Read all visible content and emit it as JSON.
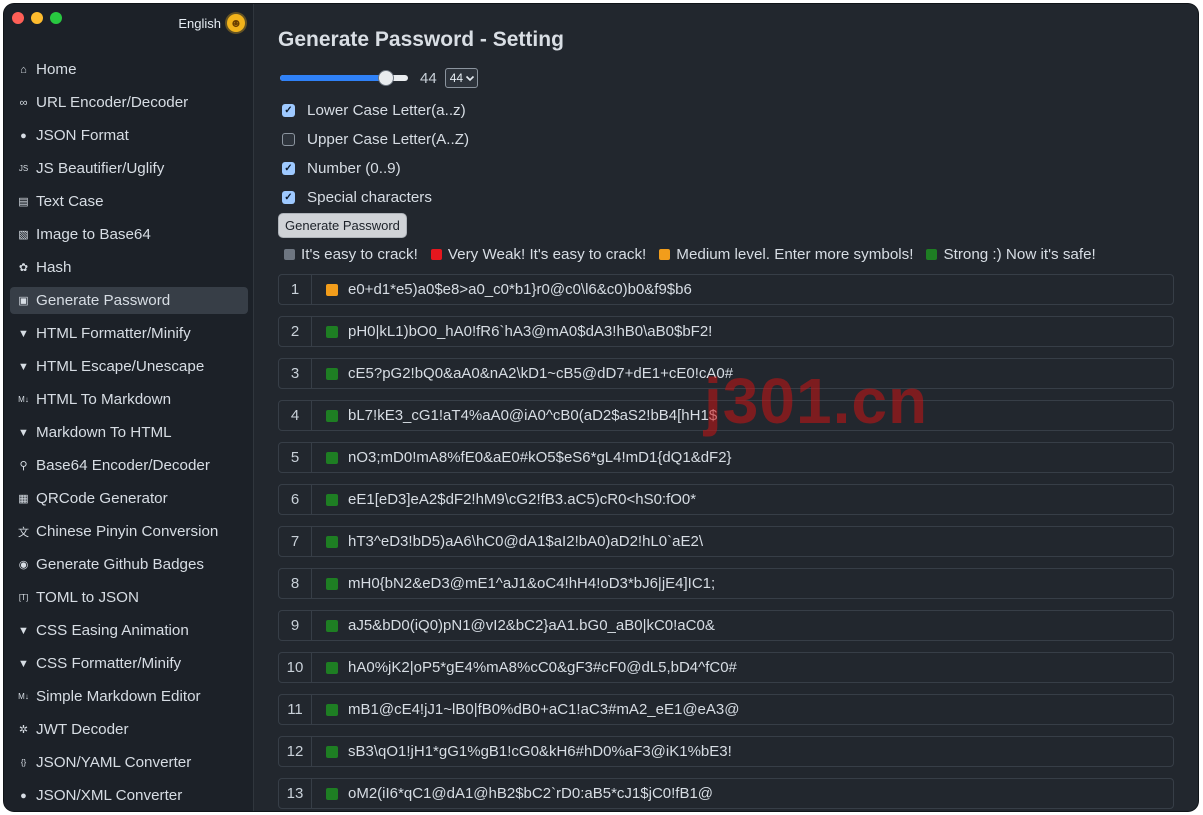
{
  "app": {
    "language": "English",
    "title": "Generate Password - Setting"
  },
  "colors": {
    "weak_gray": "#6e7681",
    "very_weak": "#e5171e",
    "medium": "#f29d1b",
    "strong": "#1e7e23"
  },
  "sidebar": {
    "items": [
      {
        "label": "Home",
        "icon": "home-icon"
      },
      {
        "label": "URL Encoder/Decoder",
        "icon": "link-icon"
      },
      {
        "label": "JSON Format",
        "icon": "json-icon"
      },
      {
        "label": "JS Beautifier/Uglify",
        "icon": "js-icon"
      },
      {
        "label": "Text Case",
        "icon": "text-case-icon"
      },
      {
        "label": "Image to Base64",
        "icon": "image-icon"
      },
      {
        "label": "Hash",
        "icon": "hash-icon"
      },
      {
        "label": "Generate Password",
        "icon": "lock-icon",
        "active": true
      },
      {
        "label": "HTML Formatter/Minify",
        "icon": "html5-icon"
      },
      {
        "label": "HTML Escape/Unescape",
        "icon": "html5-icon"
      },
      {
        "label": "HTML To Markdown",
        "icon": "markdown-icon"
      },
      {
        "label": "Markdown To HTML",
        "icon": "html5-icon"
      },
      {
        "label": "Base64 Encoder/Decoder",
        "icon": "bicycle-icon"
      },
      {
        "label": "QRCode Generator",
        "icon": "qrcode-icon"
      },
      {
        "label": "Chinese Pinyin Conversion",
        "icon": "translate-icon"
      },
      {
        "label": "Generate Github Badges",
        "icon": "github-icon"
      },
      {
        "label": "TOML to JSON",
        "icon": "toml-icon"
      },
      {
        "label": "CSS Easing Animation",
        "icon": "css3-icon"
      },
      {
        "label": "CSS Formatter/Minify",
        "icon": "css3-icon"
      },
      {
        "label": "Simple Markdown Editor",
        "icon": "markdown-icon"
      },
      {
        "label": "JWT Decoder",
        "icon": "jwt-icon"
      },
      {
        "label": "JSON/YAML Converter",
        "icon": "braces-icon"
      },
      {
        "label": "JSON/XML Converter",
        "icon": "json-icon"
      }
    ]
  },
  "settings": {
    "length_value": "44",
    "length_selected": "44",
    "length_fraction": 0.83,
    "options": [
      {
        "label": "Lower Case Letter(a..z)",
        "checked": true
      },
      {
        "label": "Upper Case Letter(A..Z)",
        "checked": false
      },
      {
        "label": "Number (0..9)",
        "checked": true
      },
      {
        "label": "Special characters",
        "checked": true
      }
    ],
    "generate_label": "Generate Password"
  },
  "legend": [
    {
      "color": "#6e7681",
      "text": "It's easy to crack!"
    },
    {
      "color": "#e5171e",
      "text": "Very Weak! It's easy to crack!"
    },
    {
      "color": "#f29d1b",
      "text": "Medium level. Enter more symbols!"
    },
    {
      "color": "#1e7e23",
      "text": "Strong :) Now it's safe!"
    }
  ],
  "passwords": [
    {
      "n": "1",
      "strength": "#f29d1b",
      "value": "e0+d1*e5)a0$e8>a0_c0*b1}r0@c0\\l6&c0)b0&f9$b6"
    },
    {
      "n": "2",
      "strength": "#1e7e23",
      "value": "pH0|kL1)bO0_hA0!fR6`hA3@mA0$dA3!hB0\\aB0$bF2!"
    },
    {
      "n": "3",
      "strength": "#1e7e23",
      "value": "cE5?pG2!bQ0&aA0&nA2\\kD1~cB5@dD7+dE1+cE0!cA0#"
    },
    {
      "n": "4",
      "strength": "#1e7e23",
      "value": "bL7!kE3_cG1!aT4%aA0@iA0^cB0(aD2$aS2!bB4[hH1$"
    },
    {
      "n": "5",
      "strength": "#1e7e23",
      "value": "nO3;mD0!mA8%fE0&aE0#kO5$eS6*gL4!mD1{dQ1&dF2}"
    },
    {
      "n": "6",
      "strength": "#1e7e23",
      "value": "eE1[eD3]eA2$dF2!hM9\\cG2!fB3.aC5)cR0<hS0:fO0*"
    },
    {
      "n": "7",
      "strength": "#1e7e23",
      "value": "hT3^eD3!bD5)aA6\\hC0@dA1$aI2!bA0)aD2!hL0`aE2\\"
    },
    {
      "n": "8",
      "strength": "#1e7e23",
      "value": "mH0{bN2&eD3@mE1^aJ1&oC4!hH4!oD3*bJ6|jE4]IC1;"
    },
    {
      "n": "9",
      "strength": "#1e7e23",
      "value": "aJ5&bD0(iQ0)pN1@vI2&bC2}aA1.bG0_aB0|kC0!aC0&"
    },
    {
      "n": "10",
      "strength": "#1e7e23",
      "value": "hA0%jK2|oP5*gE4%mA8%cC0&gF3#cF0@dL5,bD4^fC0#"
    },
    {
      "n": "11",
      "strength": "#1e7e23",
      "value": "mB1@cE4!jJ1~lB0|fB0%dB0+aC1!aC3#mA2_eE1@eA3@"
    },
    {
      "n": "12",
      "strength": "#1e7e23",
      "value": "sB3\\qO1!jH1*gG1%gB1!cG0&kH6#hD0%aF3@iK1%bE3!"
    },
    {
      "n": "13",
      "strength": "#1e7e23",
      "value": "oM2(iI6*qC1@dA1@hB2$bC2`rD0:aB5*cJ1$jC0!fB1@"
    }
  ],
  "watermark": "j301.cn"
}
